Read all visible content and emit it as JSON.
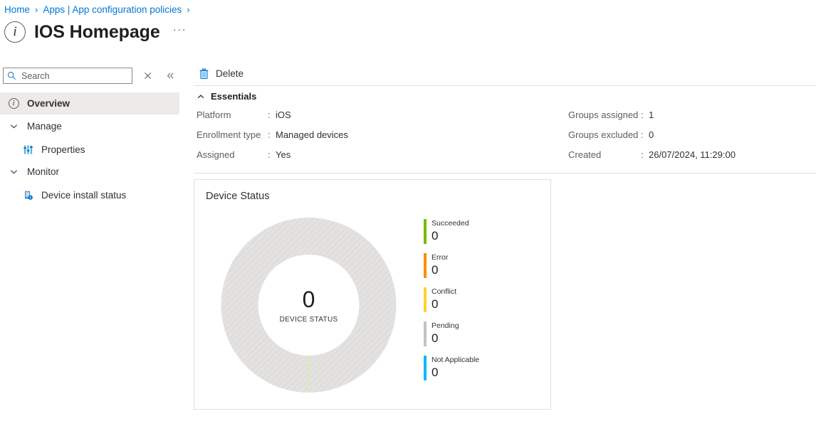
{
  "breadcrumb": {
    "items": [
      {
        "label": "Home"
      },
      {
        "label": "Apps | App configuration policies"
      }
    ],
    "separator": "›"
  },
  "header": {
    "title": "IOS Homepage",
    "icon": "info-circle-icon",
    "icon_glyph": "i",
    "more_label": "···"
  },
  "sidebar": {
    "search": {
      "placeholder": "Search",
      "value": "",
      "icon": "search-icon"
    },
    "clear_icon": "close-icon",
    "collapse_icon": "double-chevron-left-icon",
    "items": [
      {
        "label": "Overview",
        "icon": "info-circle-icon",
        "selected": true,
        "type": "item"
      },
      {
        "label": "Manage",
        "icon": "chevron-down-icon",
        "selected": false,
        "type": "group"
      },
      {
        "label": "Properties",
        "icon": "sliders-icon",
        "selected": false,
        "type": "child"
      },
      {
        "label": "Monitor",
        "icon": "chevron-down-icon",
        "selected": false,
        "type": "group"
      },
      {
        "label": "Device install status",
        "icon": "device-status-icon",
        "selected": false,
        "type": "child"
      }
    ]
  },
  "toolbar": {
    "delete_label": "Delete",
    "delete_icon": "trash-icon"
  },
  "essentials": {
    "title": "Essentials",
    "expanded": true,
    "chevron_icon": "chevron-up-icon",
    "left": [
      {
        "key": "Platform",
        "value": "iOS"
      },
      {
        "key": "Enrollment type",
        "value": "Managed devices"
      },
      {
        "key": "Assigned",
        "value": "Yes"
      }
    ],
    "right": [
      {
        "key": "Groups assigned",
        "value": "1"
      },
      {
        "key": "Groups excluded",
        "value": "0"
      },
      {
        "key": "Created",
        "value": "26/07/2024, 11:29:00"
      }
    ],
    "colon": ":"
  },
  "device_status_card": {
    "title": "Device Status",
    "center_value": "0",
    "center_caption": "DEVICE STATUS"
  },
  "chart_data": {
    "type": "pie",
    "title": "Device Status",
    "center_label": "DEVICE STATUS",
    "center_value": 0,
    "total": 0,
    "categories": [
      "Succeeded",
      "Error",
      "Conflict",
      "Pending",
      "Not Applicable"
    ],
    "values": [
      0,
      0,
      0,
      0,
      0
    ],
    "colors": [
      "#7ab800",
      "#ff8c00",
      "#ffd233",
      "#bdc3c7",
      "#00bcf2"
    ],
    "empty_ring_color": "#e2e1e0",
    "empty_ring_hatched": true,
    "marker_color": "#dfeab0",
    "legend_position": "right",
    "legend": [
      {
        "label": "Succeeded",
        "value": "0",
        "color": "#7ab800"
      },
      {
        "label": "Error",
        "value": "0",
        "color": "#ff8c00"
      },
      {
        "label": "Conflict",
        "value": "0",
        "color": "#ffd233"
      },
      {
        "label": "Pending",
        "value": "0",
        "color": "#bdc3c7"
      },
      {
        "label": "Not Applicable",
        "value": "0",
        "color": "#00bcf2"
      }
    ]
  },
  "colors": {
    "accent": "#0078d4",
    "selected_bg": "#edebe9",
    "divider": "#e1dfdd",
    "text": "#323130",
    "muted": "#605e5c"
  }
}
